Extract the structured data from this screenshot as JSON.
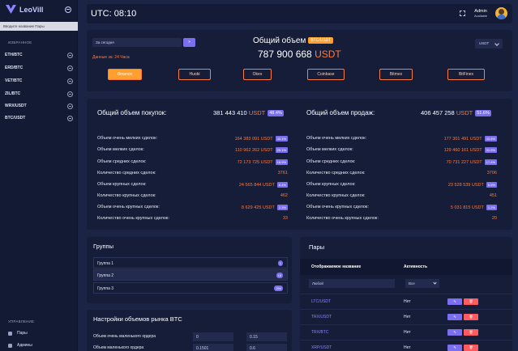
{
  "sidebar": {
    "logo_text": "LeoVill",
    "pair_search_placeholder": "Вводите название Пары",
    "favorites_title": "ИЗБРАННОЕ",
    "favorites": [
      "ETH/BTC",
      "ERD/BTC",
      "VET/BTC",
      "ZIL/BTC",
      "WRX/USDT",
      "BTC/USDT"
    ],
    "manage_title": "УПРАВЛЕНИЕ",
    "nav": [
      "Пары",
      "Админы"
    ]
  },
  "header": {
    "utc": "UTC: 08:10",
    "admin_name": "Admin",
    "admin_status": "Available"
  },
  "top": {
    "date_placeholder": "За сегодня",
    "date_button": "»",
    "date_note": "Данные за: 24 Часа",
    "title": "Общий объем",
    "title_badge": "BTC/USDT",
    "total_amount": "787 900 668",
    "total_currency": "USDT",
    "currency_select": "USDT",
    "exchanges": [
      "Binance",
      "Huobi",
      "Okex",
      "Coinbase",
      "Bitmex",
      "BitFinex"
    ]
  },
  "volumes": {
    "buy": {
      "title": "Общий объем покупок:",
      "amount": "381 443 410",
      "currency": "USDT",
      "percent": "48.4%",
      "rows": [
        {
          "label": "Объем очень мелких сделок:",
          "value": "164 383 091 USDT",
          "pct": "43.1%"
        },
        {
          "label": "Объем мелких сделок:",
          "value": "110 962 262 USDT",
          "pct": "29.1%"
        },
        {
          "label": "Объем средних сделок:",
          "value": "72 173 725 USDT",
          "pct": "18.9%"
        },
        {
          "label": "Количество средних сделок:",
          "value": "3761",
          "pct": ""
        },
        {
          "label": "Объем крупных сделок:",
          "value": "24 565 844 USDT",
          "pct": "6.4%"
        },
        {
          "label": "Количество крупных сделок:",
          "value": "462",
          "pct": ""
        },
        {
          "label": "Объем очень крупных сделок:",
          "value": "8 629 425 USDT",
          "pct": "2.3%"
        },
        {
          "label": "Количество очень крупных сделок:",
          "value": "33",
          "pct": ""
        }
      ]
    },
    "sell": {
      "title": "Общий объем продаж:",
      "amount": "406 457 258",
      "currency": "USDT",
      "percent": "51.6%",
      "rows": [
        {
          "label": "Объем очень мелких сделок:",
          "value": "177 301 491 USDT",
          "pct": "43.6%"
        },
        {
          "label": "Объем мелких сделок:",
          "value": "129 460 161 USDT",
          "pct": "31.9%"
        },
        {
          "label": "Объем средних сделок:",
          "value": "70 731 227 USDT",
          "pct": "17.4%"
        },
        {
          "label": "Количество средних сделок:",
          "value": "3706",
          "pct": ""
        },
        {
          "label": "Объем крупных сделок:",
          "value": "23 528 539 USDT",
          "pct": "5.8%"
        },
        {
          "label": "Количество крупных сделок:",
          "value": "451",
          "pct": ""
        },
        {
          "label": "Объем очень крупных сделок:",
          "value": "5 031 815 USDT",
          "pct": "1.2%"
        },
        {
          "label": "Количество очень крупных сделок:",
          "value": "20",
          "pct": ""
        }
      ]
    }
  },
  "groups": {
    "title": "Группы",
    "items": [
      {
        "label": "Группа 1",
        "count": "1"
      },
      {
        "label": "Группа 2",
        "count": "18"
      },
      {
        "label": "Группа 3",
        "count": "294"
      }
    ]
  },
  "settings": {
    "title": "Настройки объемов рынка BTC",
    "rows": [
      {
        "label": "Объем очень маленького ордера",
        "v1": "0",
        "v2": "0.15"
      },
      {
        "label": "Объем маленького ордера",
        "v1": "0.1501",
        "v2": "0.6"
      }
    ]
  },
  "pairs": {
    "title": "Пары",
    "col_name": "Отображаемое название",
    "col_activity": "Активность",
    "filter_placeholder": "Любой",
    "filter_select": "Все",
    "rows": [
      {
        "name": "LTC/USDT",
        "activity": "Нет"
      },
      {
        "name": "TRX/USDT",
        "activity": "Нет"
      },
      {
        "name": "TRX/BTC",
        "activity": "Нет"
      },
      {
        "name": "XRP/USDT",
        "activity": "Нет"
      }
    ],
    "edit_label": "✎",
    "delete_label": "🗑"
  }
}
